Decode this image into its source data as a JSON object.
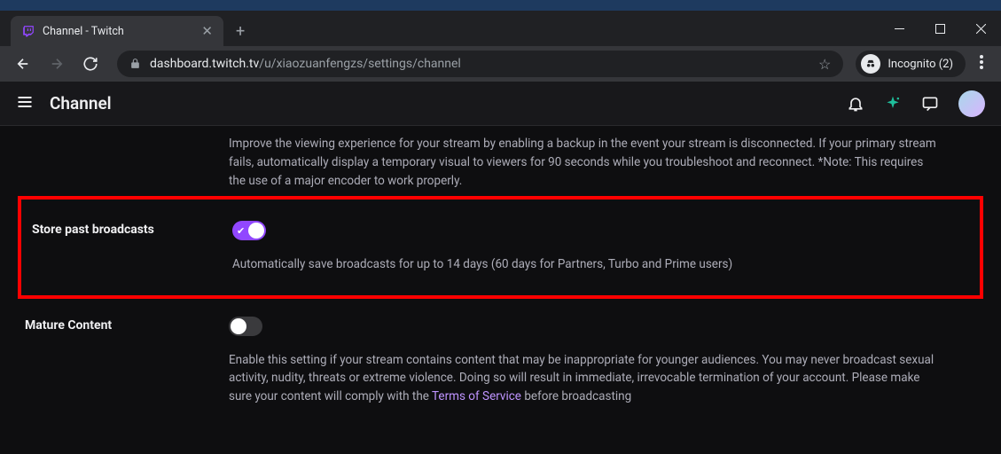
{
  "browser": {
    "tab_title": "Channel - Twitch",
    "url_host": "dashboard.twitch.tv",
    "url_path": "/u/xiaozuanfengzs/settings/channel",
    "incognito_label": "Incognito (2)"
  },
  "header": {
    "title": "Channel"
  },
  "settings": {
    "disconnect_protection": {
      "description": "Improve the viewing experience for your stream by enabling a backup in the event your stream is disconnected. If your primary stream fails, automatically display a temporary visual to viewers for 90 seconds while you troubleshoot and reconnect. *Note: This requires the use of a major encoder to work properly."
    },
    "store_past_broadcasts": {
      "label": "Store past broadcasts",
      "description": "Automatically save broadcasts for up to 14 days (60 days for Partners, Turbo and Prime users)"
    },
    "mature_content": {
      "label": "Mature Content",
      "desc_before": "Enable this setting if your stream contains content that may be inappropriate for younger audiences. You may never broadcast sexual activity, nudity, threats or extreme violence. Doing so will result in immediate, irrevocable termination of your account. Please make sure your content will comply with the ",
      "tos_link": "Terms of Service",
      "desc_after": " before broadcasting"
    }
  }
}
